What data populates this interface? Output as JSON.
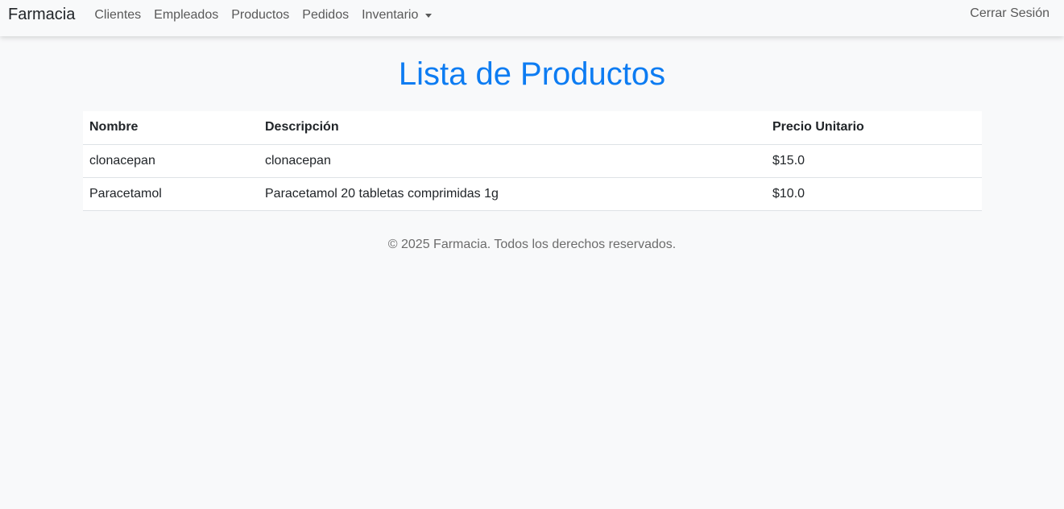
{
  "navbar": {
    "brand": "Farmacia",
    "links": [
      "Clientes",
      "Empleados",
      "Productos",
      "Pedidos",
      "Inventario"
    ],
    "logout": "Cerrar Sesión"
  },
  "page": {
    "title": "Lista de Productos"
  },
  "table": {
    "headers": [
      "Nombre",
      "Descripción",
      "Precio Unitario"
    ],
    "rows": [
      [
        "clonacepan",
        "clonacepan",
        "$15.0"
      ],
      [
        "Paracetamol",
        "Paracetamol 20 tabletas comprimidas 1g",
        "$10.0"
      ]
    ]
  },
  "footer": {
    "text": "© 2025 Farmacia. Todos los derechos reservados."
  },
  "colors": {
    "title": "#0d7cf2",
    "navbar_bg": "#f8f9fa"
  }
}
